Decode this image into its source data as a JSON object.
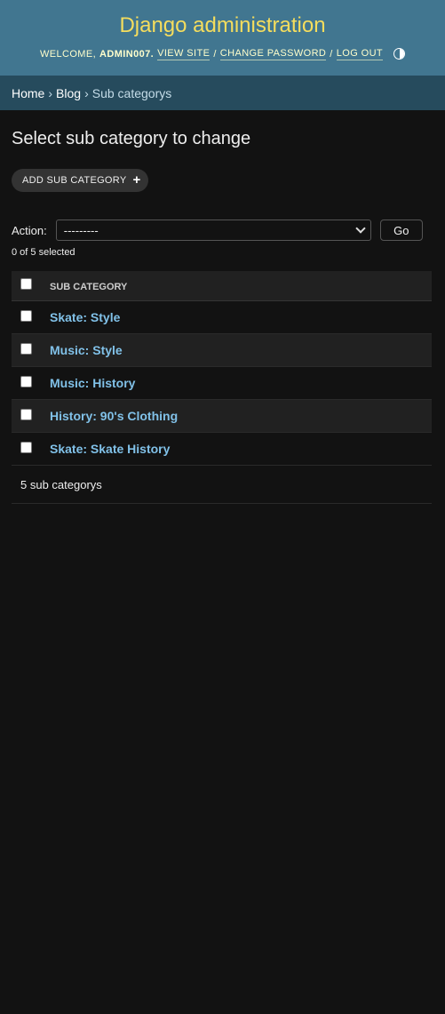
{
  "header": {
    "site_name": "Django administration",
    "welcome": "Welcome,",
    "username": "admin007.",
    "view_site": "View site",
    "change_password": "Change password",
    "log_out": "Log out",
    "separator": "/",
    "theme_icon": "theme-toggle-icon"
  },
  "breadcrumbs": {
    "home": "Home",
    "app": "Blog",
    "current": "Sub categorys",
    "separator": "›"
  },
  "page": {
    "title": "Select sub category to change",
    "add_button": "Add sub category",
    "add_icon": "+"
  },
  "actions": {
    "label": "Action:",
    "selected_option": "---------",
    "go_label": "Go",
    "selection_count": "0 of 5 selected"
  },
  "table": {
    "column_header": "Sub category",
    "rows": [
      {
        "label": "Skate: Style"
      },
      {
        "label": "Music: Style"
      },
      {
        "label": "Music: History"
      },
      {
        "label": "History: 90's Clothing"
      },
      {
        "label": "Skate: Skate History"
      }
    ],
    "paginator": "5 sub categorys"
  },
  "colors": {
    "header_bg": "#417690",
    "breadcrumbs_bg": "#264b5d",
    "brand_yellow": "#f5dd5d",
    "link_blue": "#81c1e8",
    "page_bg": "#121212"
  }
}
